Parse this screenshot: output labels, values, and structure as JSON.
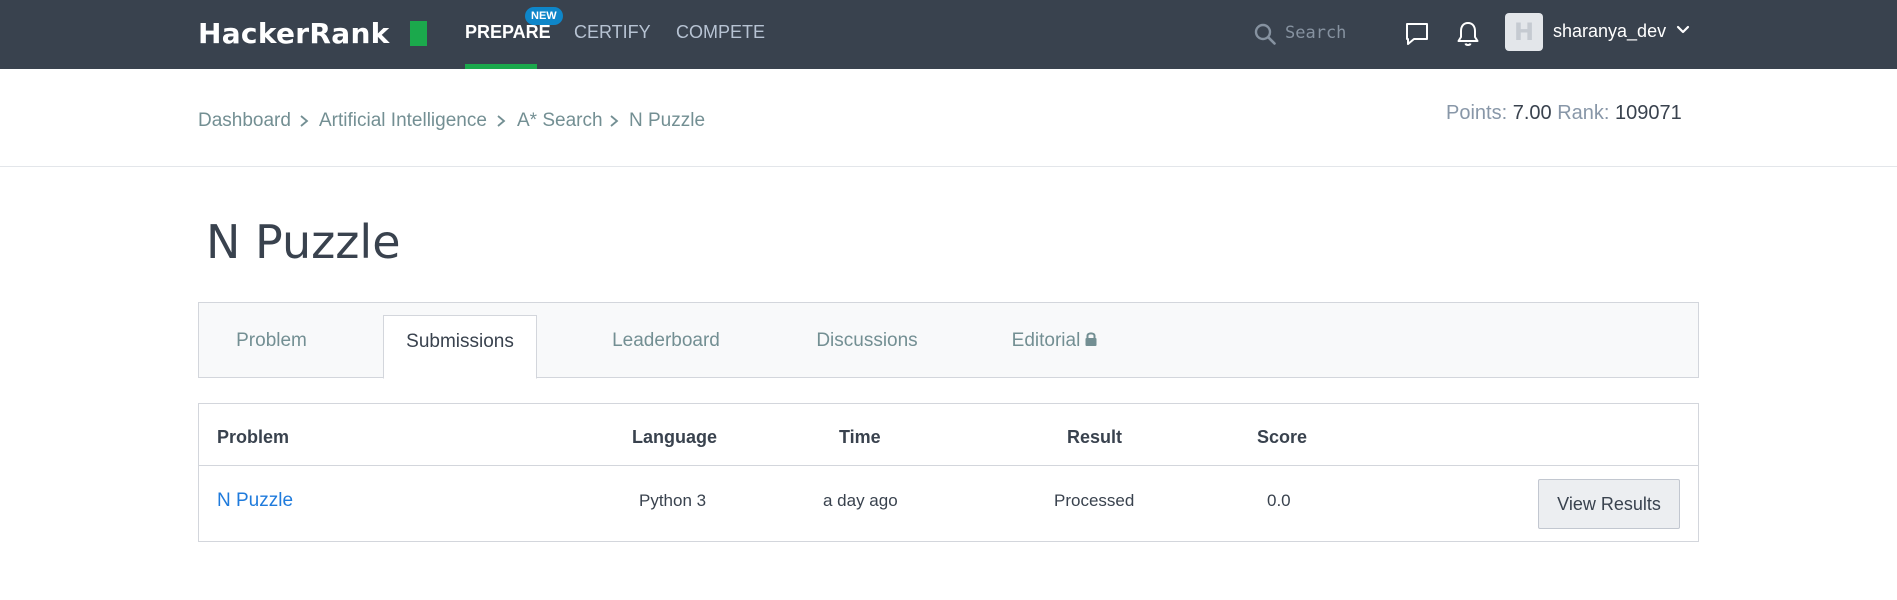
{
  "nav": {
    "logo": "HackerRank",
    "items": [
      {
        "label": "PREPARE",
        "badge": "NEW",
        "active": true
      },
      {
        "label": "CERTIFY",
        "active": false
      },
      {
        "label": "COMPETE",
        "active": false
      }
    ],
    "search_placeholder": "Search",
    "avatar_initial": "H",
    "username": "sharanya_dev",
    "icons": [
      "search-icon",
      "chat-icon",
      "bell-icon",
      "chevron-down-icon"
    ]
  },
  "breadcrumb": [
    "Dashboard",
    "Artificial Intelligence",
    "A* Search",
    "N Puzzle"
  ],
  "stats": {
    "points_label": "Points:",
    "points": "7.00",
    "rank_label": "Rank:",
    "rank": "109071"
  },
  "title": "N Puzzle",
  "tabs": [
    "Problem",
    "Submissions",
    "Leaderboard",
    "Discussions",
    "Editorial"
  ],
  "active_tab": "Submissions",
  "table": {
    "headers": [
      "Problem",
      "Language",
      "Time",
      "Result",
      "Score"
    ],
    "rows": [
      {
        "problem": "N Puzzle",
        "language": "Python 3",
        "time": "a day ago",
        "result": "Processed",
        "score": "0.0",
        "action": "View Results"
      }
    ]
  },
  "colors": {
    "nav_bg": "#39424e",
    "accent_green": "#1ba94c",
    "badge_blue": "#0e86c9",
    "link_blue": "#1f7bdc"
  }
}
